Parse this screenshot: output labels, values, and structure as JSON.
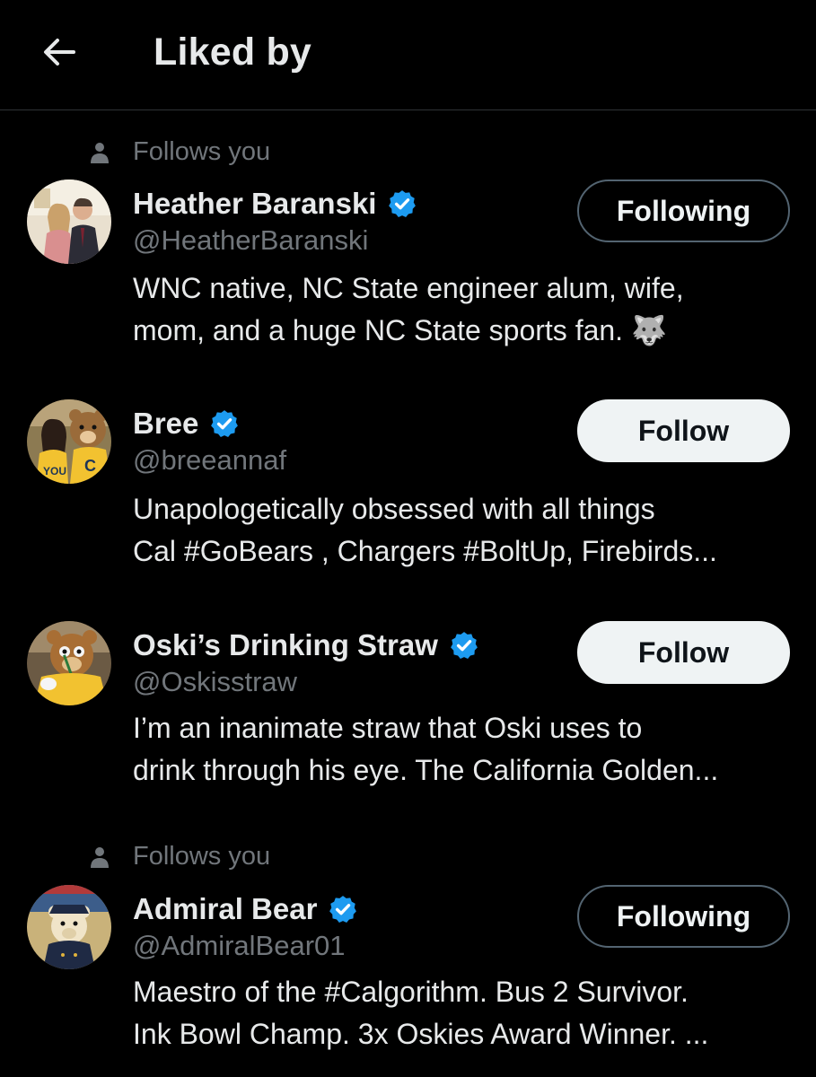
{
  "header": {
    "title": "Liked by",
    "back_icon": "arrow-left-icon"
  },
  "colors": {
    "background": "#000000",
    "text": "#e7e9ea",
    "muted": "#71767b",
    "verified": "#1d9bf0",
    "follow_button": "#eff3f4"
  },
  "users": [
    {
      "social_context": "Follows you",
      "name": "Heather Baranski",
      "verified": true,
      "handle": "@HeatherBaranski",
      "bio_lines": [
        "WNC native, NC State engineer alum, wife,",
        "mom, and a huge NC State sports fan. 🐺"
      ],
      "button": "Following"
    },
    {
      "social_context": "",
      "name": "Bree",
      "verified": true,
      "handle": "@breeannaf",
      "bio_lines": [
        "Unapologetically obsessed with all things",
        "Cal #GoBears , Chargers #BoltUp, Firebirds..."
      ],
      "button": "Follow"
    },
    {
      "social_context": "",
      "name": "Oski’s Drinking Straw",
      "verified": true,
      "handle": "@Oskisstraw",
      "bio_lines": [
        "I’m an inanimate straw that Oski uses to",
        "drink through his eye. The California Golden..."
      ],
      "button": "Follow"
    },
    {
      "social_context": "Follows you",
      "name": "Admiral Bear",
      "verified": true,
      "handle": "@AdmiralBear01",
      "bio_lines": [
        "Maestro of the #Calgorithm. Bus 2 Survivor.",
        "Ink Bowl Champ. 3x Oskies Award Winner. ..."
      ],
      "button": "Following"
    }
  ]
}
